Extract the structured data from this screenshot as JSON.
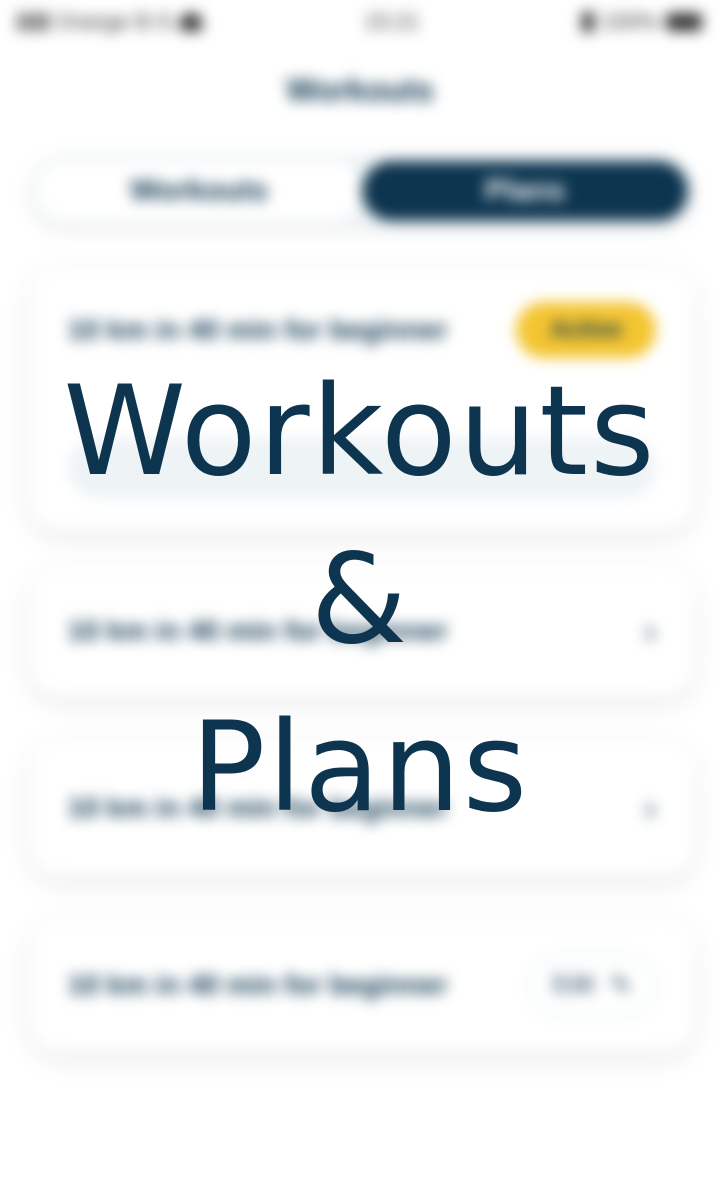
{
  "status_bar": {
    "carrier": "Orange B-S",
    "time": "15:21",
    "battery": "100%"
  },
  "header": {
    "title": "Workouts"
  },
  "segmented": {
    "tab_workouts": "Workouts",
    "tab_plans": "Plans"
  },
  "cards": [
    {
      "text": "10 km in 40 min for beginner",
      "badge": "Active"
    },
    {
      "text": "10 km in 40 min for beginner"
    },
    {
      "text": "10 km in 40 min for beginner"
    },
    {
      "text": "10 km in 40 min for beginner",
      "action": "Edit"
    }
  ],
  "overlay": {
    "line1": "Workouts",
    "line2": "&",
    "line3": "Plans"
  },
  "colors": {
    "brand_navy": "#0d3550",
    "badge_yellow": "#f4c531",
    "background": "#ffffff"
  },
  "icons": [
    "signal-icon",
    "wifi-icon",
    "bluetooth-icon",
    "battery-icon",
    "chevron-right-icon",
    "pencil-icon"
  ]
}
